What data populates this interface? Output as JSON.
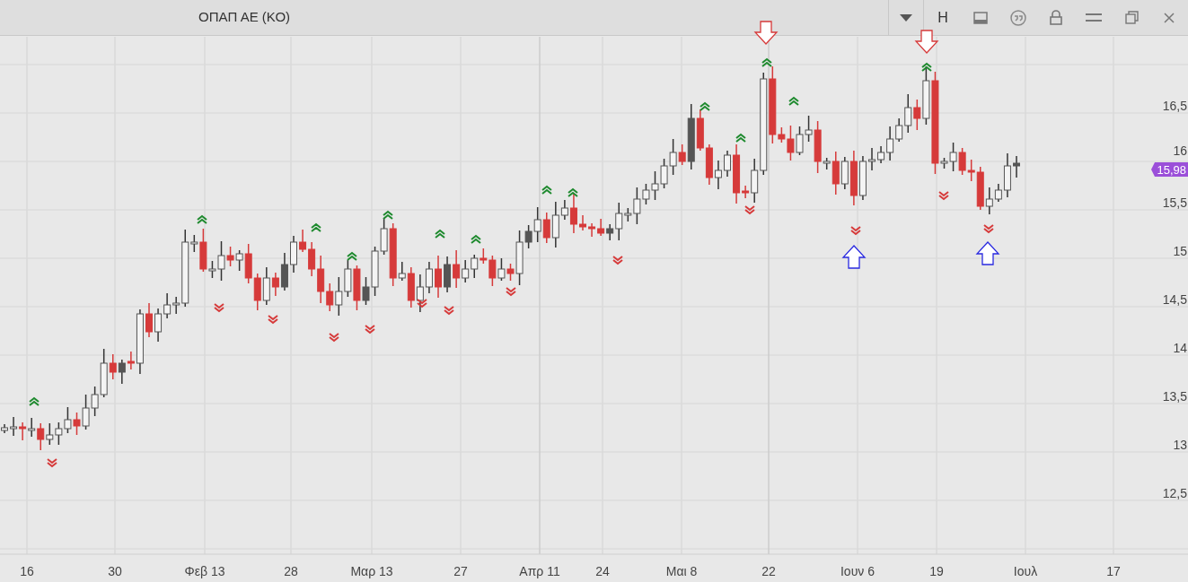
{
  "window": {
    "title": "ΟΠΑΠ ΑΕ (ΚΟ)"
  },
  "toolbar": {
    "letter_button": "H"
  },
  "price_axis": {
    "labels": [
      "16,5",
      "16",
      "15,5",
      "15",
      "14,5",
      "14",
      "13,5",
      "13",
      "12,5"
    ]
  },
  "last_price": {
    "label": "15,98",
    "color": "#9b4fd9"
  },
  "date_axis": {
    "labels": [
      "16",
      "30",
      "Φεβ 13",
      "28",
      "Μαρ 13",
      "27",
      "Απρ 11",
      "24",
      "Μαι 8",
      "22",
      "Ιουν 6",
      "19",
      "Ιουλ",
      "17"
    ]
  }
}
